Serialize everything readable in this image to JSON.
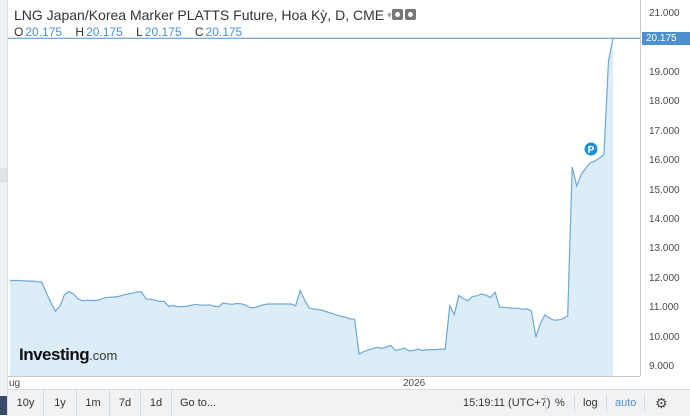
{
  "window": {
    "symbol_title": "LNG Japan/Korea Marker PLATTS Future, Hoa Kỳ, D, CME",
    "title_caret": "▾"
  },
  "ohlc": {
    "o_label": "O",
    "o_value": "20.175",
    "h_label": "H",
    "h_value": "20.175",
    "l_label": "L",
    "l_value": "20.175",
    "c_label": "C",
    "c_value": "20.175"
  },
  "price_axis": {
    "ticks": [
      "21.000",
      "20.000",
      "19.000",
      "18.000",
      "17.000",
      "16.000",
      "15.000",
      "14.000",
      "13.000",
      "12.000",
      "11.000",
      "10.000",
      "9.000"
    ],
    "last_price": "20.175"
  },
  "time_axis": {
    "left_label": "ug",
    "year_label": "2026"
  },
  "marker": {
    "label": "P"
  },
  "logo": {
    "brand": "Investing",
    "tld": ".com"
  },
  "bottom_bar": {
    "ranges": [
      "10y",
      "1y",
      "1m",
      "7d",
      "1d"
    ],
    "goto": "Go to...",
    "clock": "15:19:11 (UTC+7)",
    "percent": "%",
    "log": "log",
    "auto": "auto",
    "settings_icon": "gear-icon"
  },
  "colors": {
    "line": "#6ea8d6",
    "area": "#dcedf8",
    "accent": "#4d90cf"
  },
  "chart_data": {
    "type": "area",
    "title": "LNG Japan/Korea Marker PLATTS Future, Hoa Kỳ, D, CME",
    "xlabel": "",
    "ylabel": "",
    "ylim": [
      8.9,
      21.3
    ],
    "x_labels": [
      "ug",
      "2026"
    ],
    "values": [
      11.94,
      11.94,
      11.94,
      11.93,
      11.92,
      11.92,
      11.9,
      11.89,
      11.53,
      11.2,
      10.9,
      11.06,
      11.46,
      11.56,
      11.48,
      11.32,
      11.25,
      11.27,
      11.26,
      11.26,
      11.3,
      11.36,
      11.37,
      11.38,
      11.4,
      11.45,
      11.48,
      11.51,
      11.55,
      11.55,
      11.32,
      11.3,
      11.27,
      11.23,
      11.23,
      11.06,
      11.09,
      11.05,
      11.05,
      11.07,
      11.1,
      11.13,
      11.1,
      11.1,
      11.11,
      11.07,
      11.05,
      11.18,
      11.15,
      11.13,
      11.16,
      11.15,
      11.1,
      11.02,
      11.02,
      11.07,
      11.12,
      11.14,
      11.14,
      11.14,
      11.14,
      11.14,
      11.14,
      11.08,
      11.6,
      11.27,
      11.01,
      10.97,
      10.95,
      10.92,
      10.87,
      10.82,
      10.77,
      10.72,
      10.69,
      10.64,
      10.62,
      9.44,
      9.52,
      9.58,
      9.62,
      9.67,
      9.63,
      9.68,
      9.73,
      9.56,
      9.6,
      9.64,
      9.55,
      9.56,
      9.61,
      9.56,
      9.58,
      9.59,
      9.59,
      9.61,
      9.61,
      11.08,
      10.78,
      11.43,
      11.33,
      11.25,
      11.4,
      11.42,
      11.48,
      11.44,
      11.36,
      11.54,
      11.03,
      11.03,
      11.01,
      11.0,
      11.0,
      10.96,
      10.98,
      10.91,
      10.02,
      10.49,
      10.77,
      10.66,
      10.59,
      10.6,
      10.64,
      10.74,
      15.8,
      15.15,
      15.55,
      15.76,
      15.95,
      16.0,
      16.1,
      16.22,
      19.4,
      20.175
    ]
  }
}
